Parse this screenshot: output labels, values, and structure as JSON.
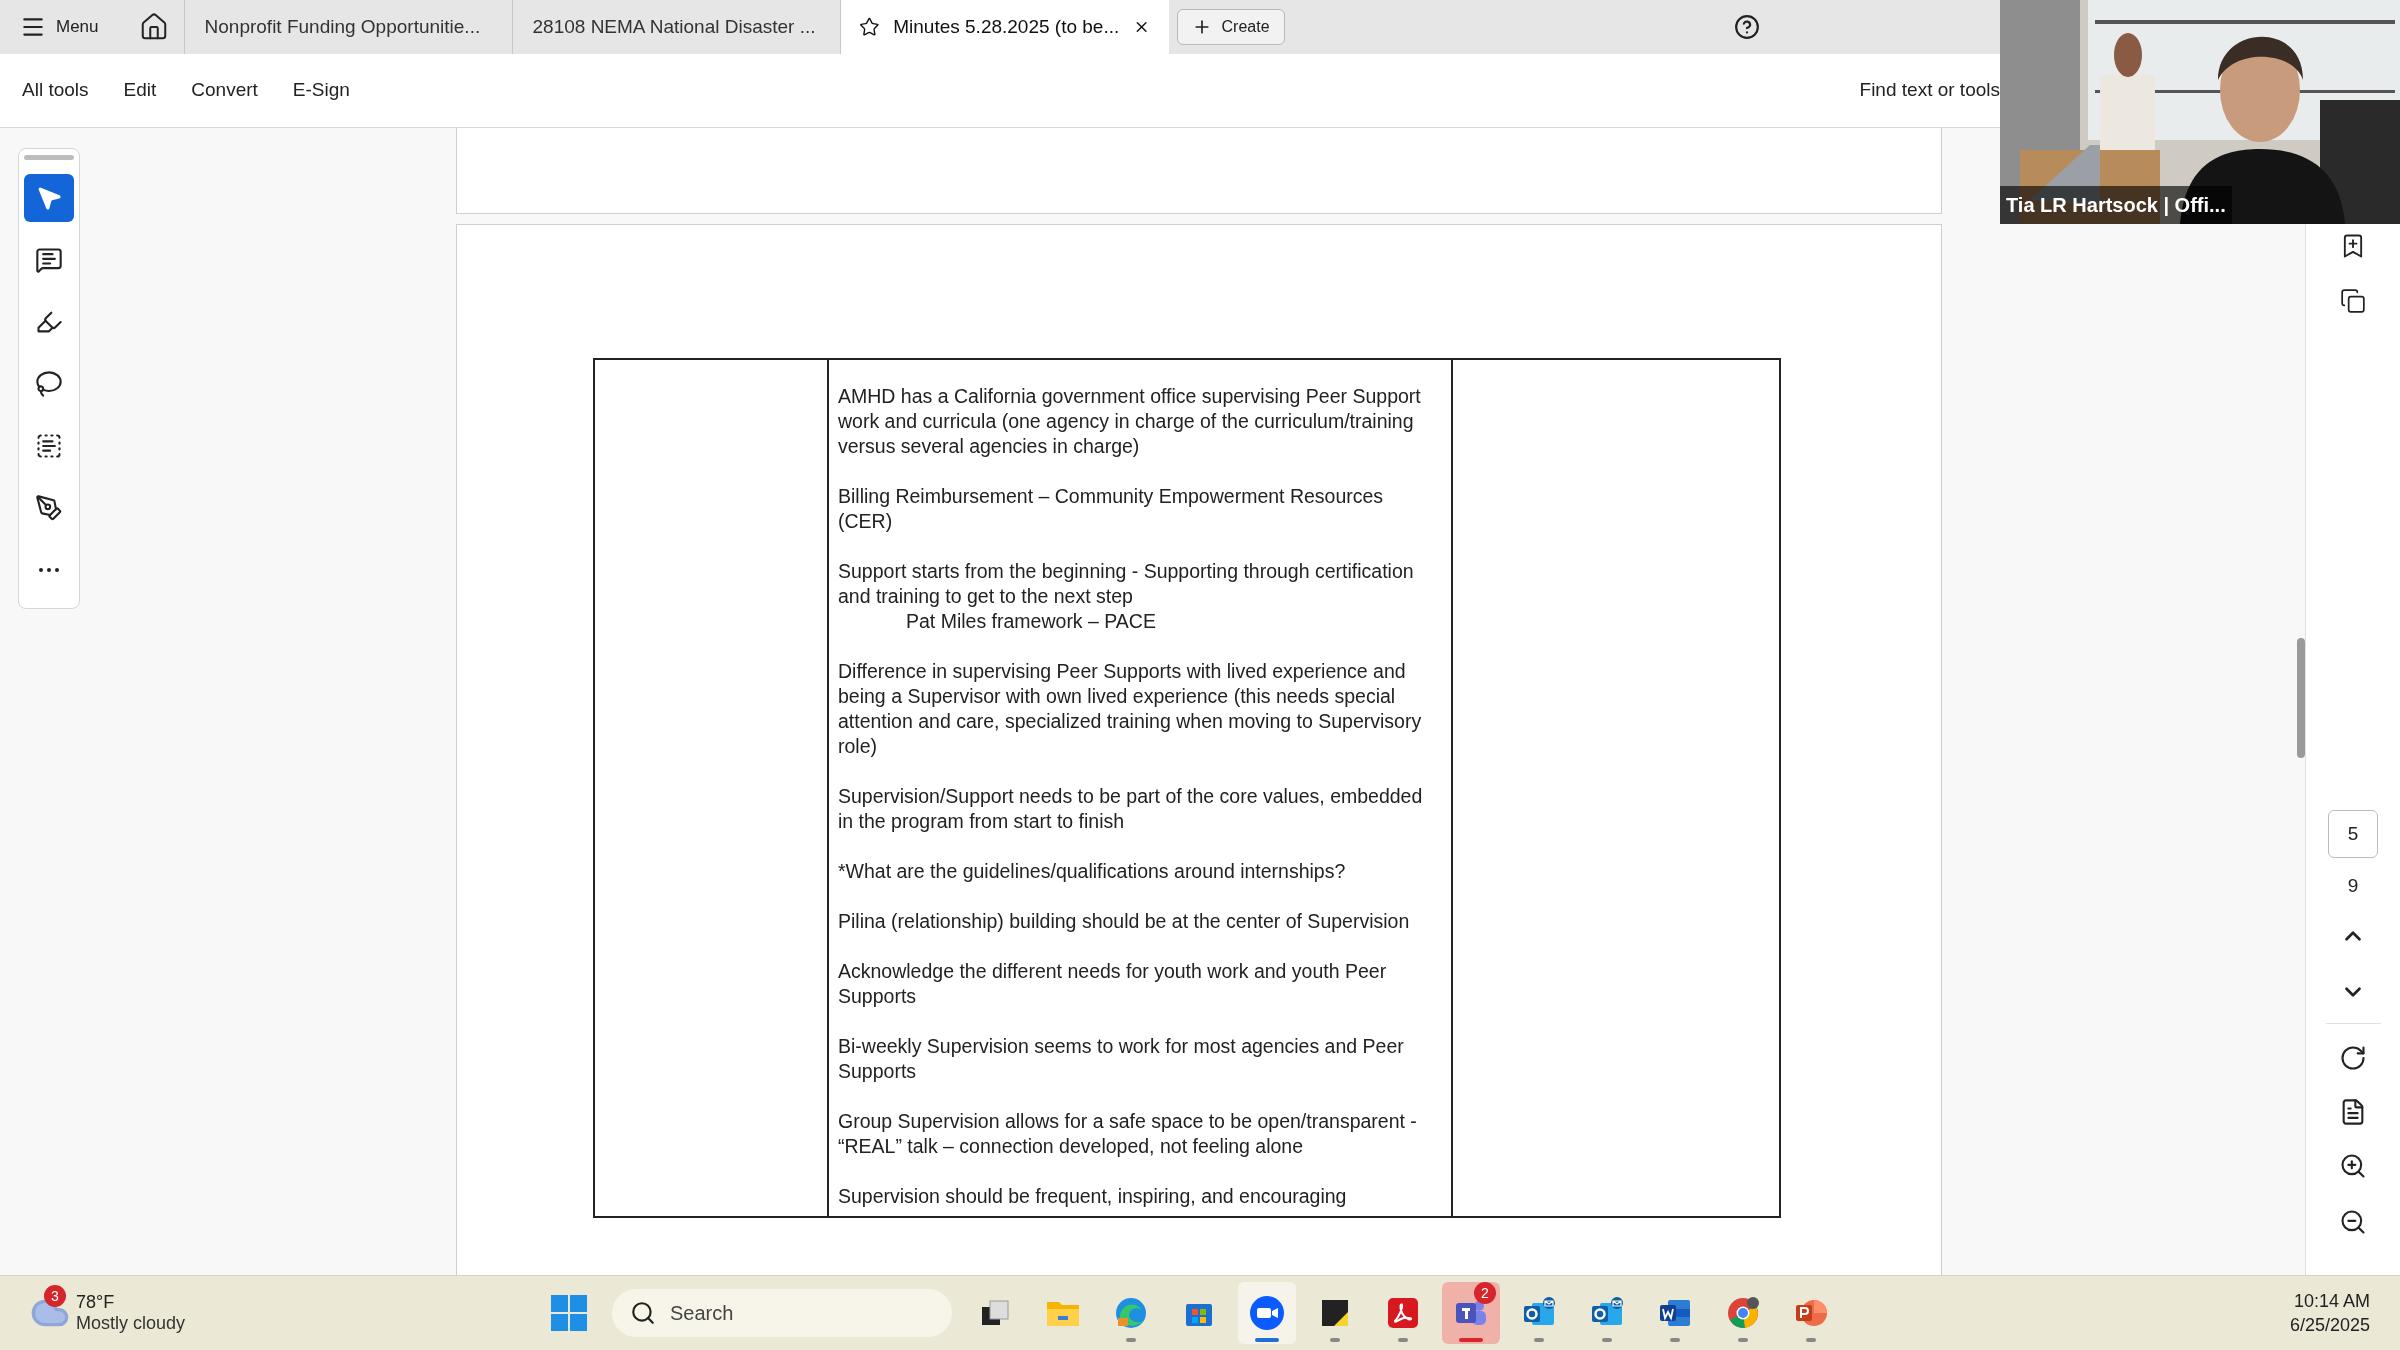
{
  "tab_bar": {
    "menu_label": "Menu",
    "tabs": [
      {
        "label": "Nonprofit Funding Opportunitie...",
        "selected": false,
        "kind": "plain"
      },
      {
        "label": "28108 NEMA National Disaster ...",
        "selected": false,
        "kind": "plain"
      },
      {
        "label": "Minutes 5.28.2025 (to be...",
        "selected": true,
        "kind": "starred"
      }
    ],
    "create_label": "Create"
  },
  "toolbar": {
    "menus": [
      "All tools",
      "Edit",
      "Convert",
      "E-Sign"
    ],
    "find_label": "Find text or tools"
  },
  "tools": [
    {
      "kind": "select",
      "selected": true
    },
    {
      "kind": "comment",
      "selected": false
    },
    {
      "kind": "highlight",
      "selected": false
    },
    {
      "kind": "draw",
      "selected": false
    },
    {
      "kind": "text",
      "selected": false
    },
    {
      "kind": "sign",
      "selected": false
    },
    {
      "kind": "more",
      "selected": false
    }
  ],
  "document": {
    "paragraphs": [
      {
        "kind": "normal",
        "lines": [
          "AMHD has a California government office supervising Peer Support",
          "work and curricula (one agency in charge of the curriculum/training",
          "versus several agencies in charge)"
        ]
      },
      {
        "kind": "normal",
        "lines": [
          "Billing Reimbursement – Community Empowerment Resources",
          "(CER)"
        ]
      },
      {
        "kind": "normal",
        "lines": [
          "Support starts from the beginning - Supporting through certification",
          "and training to get to the next step"
        ]
      },
      {
        "kind": "indented",
        "lines": [
          "Pat Miles framework – PACE"
        ]
      },
      {
        "kind": "normal",
        "lines": [
          "Difference in supervising Peer Supports with lived experience and",
          "being a Supervisor with own lived experience (this needs special",
          "attention and care, specialized training when moving to Supervisory",
          "role)"
        ]
      },
      {
        "kind": "normal",
        "lines": [
          "Supervision/Support needs to be part of the core values, embedded",
          "in the program from start to finish"
        ]
      },
      {
        "kind": "normal",
        "lines": [
          "*What are the guidelines/qualifications around internships?"
        ]
      },
      {
        "kind": "normal",
        "lines": [
          "Pilina (relationship) building should be at the center of Supervision"
        ]
      },
      {
        "kind": "normal",
        "lines": [
          "Acknowledge the different needs for youth work and youth Peer",
          "Supports"
        ]
      },
      {
        "kind": "normal",
        "lines": [
          "Bi-weekly Supervision seems to work for most agencies and Peer",
          "Supports"
        ]
      },
      {
        "kind": "normal",
        "lines": [
          "Group Supervision allows for a safe space to be open/transparent -",
          "“REAL” talk – connection developed, not feeling alone"
        ]
      },
      {
        "kind": "normal",
        "lines": [
          "Supervision should be frequent, inspiring, and encouraging"
        ]
      }
    ]
  },
  "page_nav": {
    "current_page": "5",
    "total_pages": "9"
  },
  "video": {
    "caption": "Tia LR Hartsock | Offi..."
  },
  "taskbar": {
    "weather": {
      "badge": "3",
      "temperature": "78°F",
      "condition": "Mostly cloudy"
    },
    "search_placeholder": "Search",
    "apps": [
      {
        "kind": "taskview",
        "running": false,
        "focused": false
      },
      {
        "kind": "files",
        "running": false,
        "focused": false
      },
      {
        "kind": "edge",
        "running": true,
        "focused": false
      },
      {
        "kind": "store",
        "running": false,
        "focused": false
      },
      {
        "kind": "zoom",
        "running": true,
        "focused": true
      },
      {
        "kind": "notes",
        "running": true,
        "focused": false
      },
      {
        "kind": "acrobat",
        "running": true,
        "focused": false
      },
      {
        "kind": "teams",
        "running": true,
        "focused": false,
        "badge": "2"
      },
      {
        "kind": "outlook",
        "running": true,
        "focused": false
      },
      {
        "kind": "outlook",
        "running": true,
        "focused": false
      },
      {
        "kind": "word",
        "running": true,
        "focused": false
      },
      {
        "kind": "chrome",
        "running": true,
        "focused": false
      },
      {
        "kind": "powerpoint",
        "running": true,
        "focused": false
      }
    ],
    "time": "10:14 AM",
    "date": "6/25/2025"
  }
}
